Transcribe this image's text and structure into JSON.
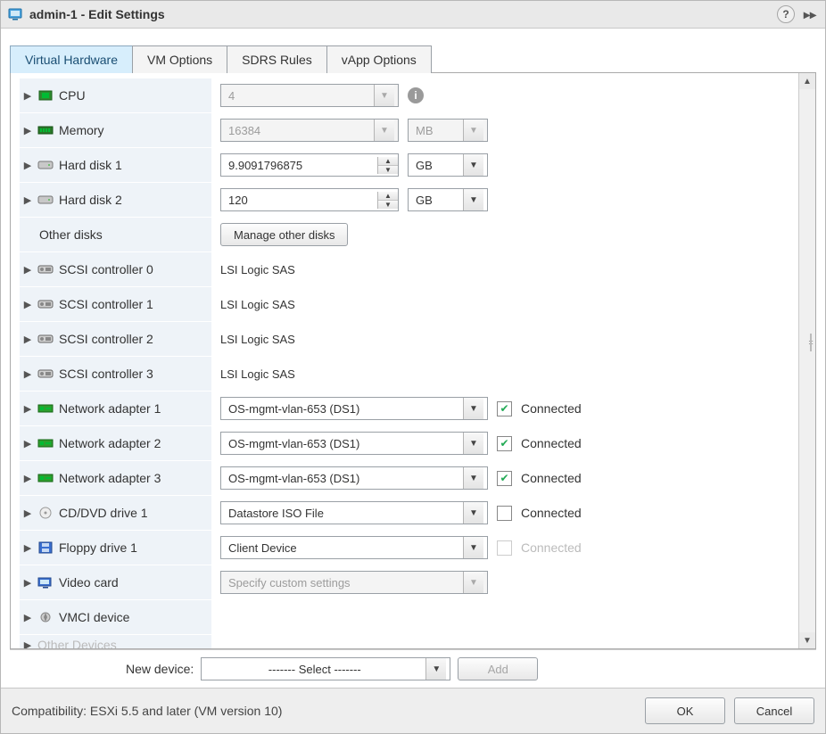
{
  "title": "admin-1 - Edit Settings",
  "tabs": {
    "t0": "Virtual Hardware",
    "t1": "VM Options",
    "t2": "SDRS Rules",
    "t3": "vApp Options"
  },
  "rows": {
    "cpu": {
      "label": "CPU",
      "value": "4"
    },
    "memory": {
      "label": "Memory",
      "value": "16384",
      "unit": "MB"
    },
    "hd1": {
      "label": "Hard disk 1",
      "value": "9.9091796875",
      "unit": "GB"
    },
    "hd2": {
      "label": "Hard disk 2",
      "value": "120",
      "unit": "GB"
    },
    "otherdisks": {
      "label": "Other disks",
      "button": "Manage other disks"
    },
    "scsi0": {
      "label": "SCSI controller 0",
      "value": "LSI Logic SAS"
    },
    "scsi1": {
      "label": "SCSI controller 1",
      "value": "LSI Logic SAS"
    },
    "scsi2": {
      "label": "SCSI controller 2",
      "value": "LSI Logic SAS"
    },
    "scsi3": {
      "label": "SCSI controller 3",
      "value": "LSI Logic SAS"
    },
    "net1": {
      "label": "Network adapter 1",
      "value": "OS-mgmt-vlan-653 (DS1)",
      "conn": "Connected",
      "checked": true
    },
    "net2": {
      "label": "Network adapter 2",
      "value": "OS-mgmt-vlan-653 (DS1)",
      "conn": "Connected",
      "checked": true
    },
    "net3": {
      "label": "Network adapter 3",
      "value": "OS-mgmt-vlan-653 (DS1)",
      "conn": "Connected",
      "checked": true
    },
    "cd": {
      "label": "CD/DVD drive 1",
      "value": "Datastore ISO File",
      "conn": "Connected",
      "checked": false
    },
    "floppy": {
      "label": "Floppy drive 1",
      "value": "Client Device",
      "conn": "Connected",
      "disabled": true
    },
    "video": {
      "label": "Video card",
      "value": "Specify custom settings"
    },
    "vmci": {
      "label": "VMCI device"
    },
    "other": {
      "label": "Other Devices"
    }
  },
  "newdev": {
    "label": "New device:",
    "select": "------- Select -------",
    "add": "Add"
  },
  "footer": {
    "compat": "Compatibility: ESXi 5.5 and later (VM version 10)",
    "ok": "OK",
    "cancel": "Cancel"
  }
}
